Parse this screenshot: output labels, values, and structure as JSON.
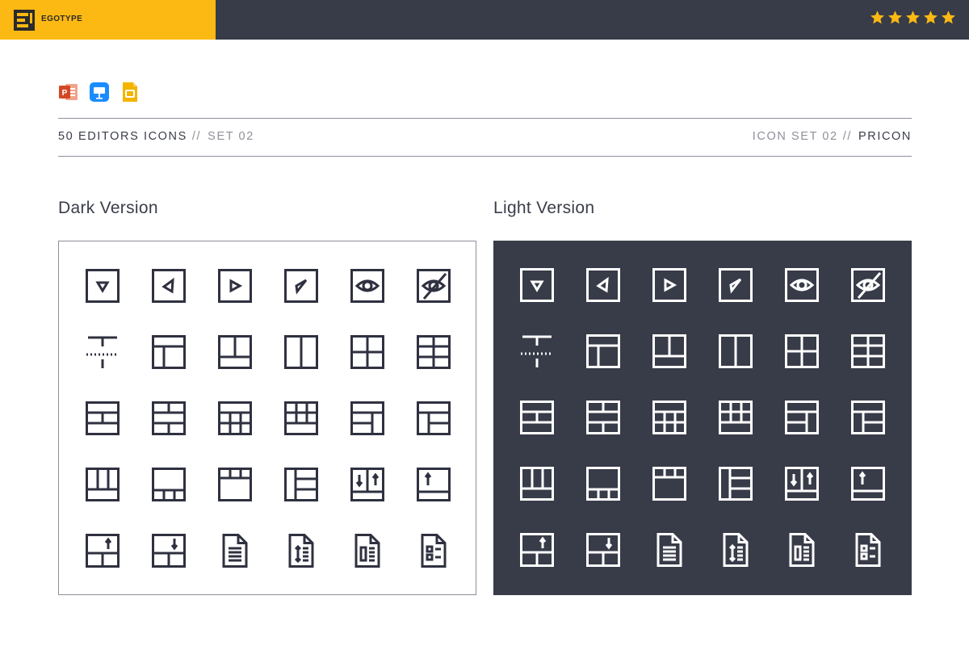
{
  "brand": {
    "name": "EGOTYPE",
    "logo_icon": "egotype-logo-icon",
    "color": "#fdb913"
  },
  "topbar": {
    "color": "#383b48"
  },
  "rating": {
    "stars": 5,
    "color": "#fdb913"
  },
  "apps": [
    {
      "name": "powerpoint-icon",
      "color": "#d24726"
    },
    {
      "name": "keynote-icon",
      "color": "#1a8cff"
    },
    {
      "name": "google-slides-icon",
      "color": "#f4b400"
    }
  ],
  "header": {
    "left_title": "50 EDITORS ICONS",
    "left_separator": "//",
    "left_subtitle": "SET 02",
    "right_title": "ICON SET 02",
    "right_separator": "//",
    "right_brand": "PRICON"
  },
  "versions": {
    "dark_title": "Dark Version",
    "light_title": "Light Version"
  },
  "colors": {
    "dark_icon": "#2f3140",
    "light_icon": "#ffffff",
    "dark_panel": "#383b48"
  },
  "icons": [
    "triangle-down-box-icon",
    "triangle-left-box-icon",
    "triangle-right-box-icon",
    "triangle-up-box-icon",
    "eye-icon",
    "eye-off-icon",
    "text-split-icon",
    "layout-header-sidebar-icon",
    "layout-top-two-columns-icon",
    "layout-two-columns-icon",
    "layout-grid-2x2-icon",
    "layout-grid-2x3-icon",
    "layout-rows-icon",
    "layout-grid-3x2-icon",
    "layout-header-grid-icon",
    "layout-header-grid-3col-icon",
    "layout-sidebar-header-icon",
    "layout-header-sidebar-right-icon",
    "layout-three-columns-top-icon",
    "layout-bottom-cells-icon",
    "layout-top-cells-icon",
    "layout-sidebar-rows-icon",
    "arrows-down-up-box-icon",
    "arrow-up-box-icon",
    "box-arrow-up-bottom-icon",
    "box-arrow-down-bottom-icon",
    "document-lines-icon",
    "document-sort-icon",
    "document-columns-icon",
    "document-list-icon"
  ]
}
